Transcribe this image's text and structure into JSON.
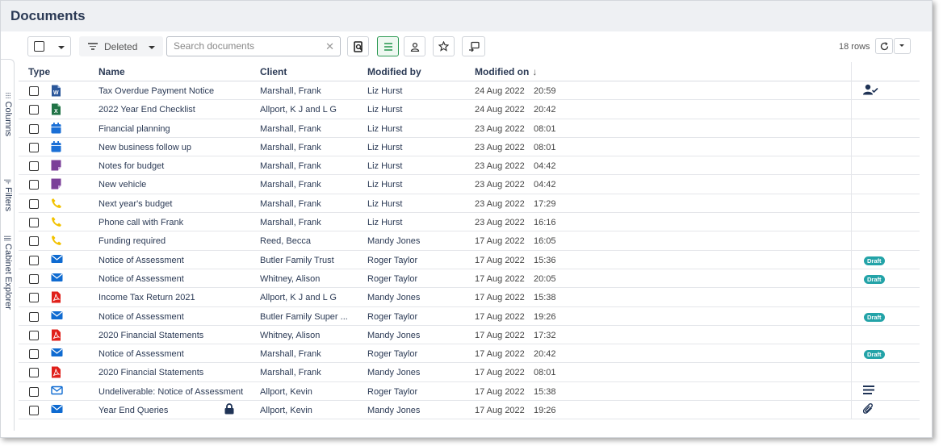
{
  "page": {
    "title": "Documents"
  },
  "side_rail": [
    {
      "label": "Columns",
      "icon": "grid-icon",
      "glyph": "⁝⁝⁝"
    },
    {
      "label": "Filters",
      "icon": "filter-icon",
      "glyph": "|⊦"
    },
    {
      "label": "Cabinet Explorer",
      "icon": "columns-icon",
      "glyph": "|||"
    }
  ],
  "toolbar": {
    "filter_label": "Deleted",
    "search_placeholder": "Search documents",
    "search_value": "",
    "clear_glyph": "✕",
    "rows_label": "18 rows",
    "accent_color": "#2e9a55"
  },
  "table": {
    "headers": {
      "type": "Type",
      "name": "Name",
      "client": "Client",
      "modified_by": "Modified by",
      "modified_on": "Modified on",
      "sort_glyph": "↓"
    },
    "rows": [
      {
        "type": "word",
        "name": "Tax Overdue Payment Notice",
        "client": "Marshall, Frank",
        "modified_by": "Liz Hurst",
        "date": "24 Aug 2022",
        "time": "20:59",
        "action": "user-check-icon"
      },
      {
        "type": "excel",
        "name": "2022 Year End Checklist",
        "client": "Allport, K J and L G",
        "modified_by": "Liz Hurst",
        "date": "24 Aug 2022",
        "time": "20:42",
        "action": ""
      },
      {
        "type": "calendar",
        "name": "Financial planning",
        "client": "Marshall, Frank",
        "modified_by": "Liz Hurst",
        "date": "23 Aug 2022",
        "time": "08:01",
        "action": ""
      },
      {
        "type": "calendar",
        "name": "New business follow up",
        "client": "Marshall, Frank",
        "modified_by": "Liz Hurst",
        "date": "23 Aug 2022",
        "time": "08:01",
        "action": ""
      },
      {
        "type": "note",
        "name": "Notes for budget",
        "client": "Marshall, Frank",
        "modified_by": "Liz Hurst",
        "date": "23 Aug 2022",
        "time": "04:42",
        "action": ""
      },
      {
        "type": "note",
        "name": "New vehicle",
        "client": "Marshall, Frank",
        "modified_by": "Liz Hurst",
        "date": "23 Aug 2022",
        "time": "04:42",
        "action": ""
      },
      {
        "type": "phone",
        "name": "Next year's budget",
        "client": "Marshall, Frank",
        "modified_by": "Liz Hurst",
        "date": "23 Aug 2022",
        "time": "17:29",
        "action": ""
      },
      {
        "type": "phone",
        "name": "Phone call with Frank",
        "client": "Marshall, Frank",
        "modified_by": "Liz Hurst",
        "date": "23 Aug 2022",
        "time": "16:16",
        "action": ""
      },
      {
        "type": "phone",
        "name": "Funding required",
        "client": "Reed, Becca",
        "modified_by": "Mandy Jones",
        "date": "17 Aug 2022",
        "time": "16:05",
        "action": ""
      },
      {
        "type": "email",
        "name": "Notice of Assessment",
        "client": "Butler Family Trust",
        "modified_by": "Roger Taylor",
        "date": "17 Aug 2022",
        "time": "15:36",
        "action": "draft"
      },
      {
        "type": "email",
        "name": "Notice of Assessment",
        "client": "Whitney, Alison",
        "modified_by": "Roger Taylor",
        "date": "17 Aug 2022",
        "time": "20:05",
        "action": "draft"
      },
      {
        "type": "pdf",
        "name": "Income Tax Return 2021",
        "client": "Allport, K J and L G",
        "modified_by": "Mandy Jones",
        "date": "17 Aug 2022",
        "time": "15:38",
        "action": ""
      },
      {
        "type": "email",
        "name": "Notice of Assessment",
        "client": "Butler Family Super ...",
        "modified_by": "Roger Taylor",
        "date": "17 Aug 2022",
        "time": "19:26",
        "action": "draft"
      },
      {
        "type": "pdf",
        "name": "2020 Financial Statements",
        "client": "Whitney, Alison",
        "modified_by": "Mandy Jones",
        "date": "17 Aug 2022",
        "time": "17:32",
        "action": ""
      },
      {
        "type": "email",
        "name": "Notice of Assessment",
        "client": "Marshall, Frank",
        "modified_by": "Roger Taylor",
        "date": "17 Aug 2022",
        "time": "20:42",
        "action": "draft"
      },
      {
        "type": "pdf",
        "name": "2020 Financial Statements",
        "client": "Marshall, Frank",
        "modified_by": "Mandy Jones",
        "date": "17 Aug 2022",
        "time": "08:01",
        "action": ""
      },
      {
        "type": "email-outline",
        "name": "Undeliverable: Notice of Assessment",
        "client": "Allport, Kevin",
        "modified_by": "Roger Taylor",
        "date": "17 Aug 2022",
        "time": "15:38",
        "action": "list-icon"
      },
      {
        "type": "email",
        "name": "Year End Queries",
        "client": "Allport, Kevin",
        "modified_by": "Mandy Jones",
        "date": "17 Aug 2022",
        "time": "19:26",
        "action": "paperclip-icon",
        "locked": true
      }
    ],
    "draft_label": "Draft"
  },
  "colors": {
    "word": "#2b579a",
    "excel": "#217346",
    "calendar": "#1a6fd6",
    "note": "#7b3f99",
    "phone": "#f2c200",
    "email": "#0f6bd1",
    "pdf": "#e0201b",
    "text": "#2b3a55",
    "draft": "#23a3a8"
  }
}
